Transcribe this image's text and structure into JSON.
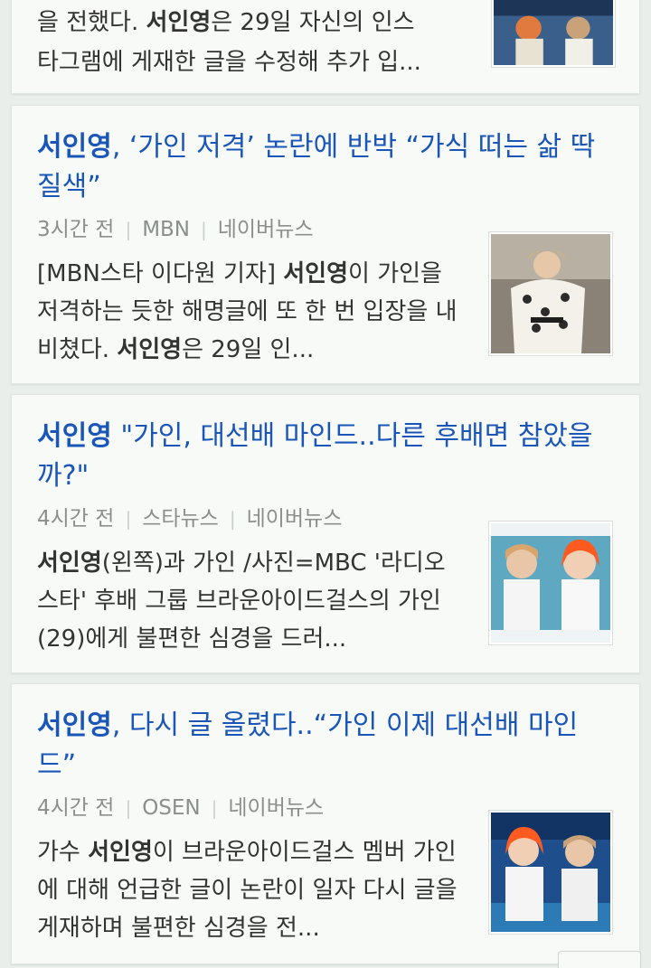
{
  "articles": [
    {
      "snippet_line1_pre": "을 전했다. ",
      "snippet_line1_hl": "서인영",
      "snippet_line1_post": "은 29일 자신의 인스",
      "snippet_line2": "타그램에 게재한 글을 수정해 추가 입..."
    },
    {
      "title_hl": "서인영",
      "title_rest": ", ‘가인 저격’ 논란에 반박 “가식 떠는 삶 딱 질색”",
      "time": "3시간 전",
      "press": "MBN",
      "source": "네이버뉴스",
      "snippet_pre": "[MBN스타 이다원 기자] ",
      "snippet_hl1": "서인영",
      "snippet_mid": "이 가인을 저격하는 듯한 해명글에 또 한 번 입장을 내비쳤다. ",
      "snippet_hl2": "서인영",
      "snippet_post": "은 29일 인..."
    },
    {
      "title_hl": "서인영",
      "title_rest": " \"가인, 대선배 마인드..다른 후배면 참았을까?\"",
      "time": "4시간 전",
      "press": "스타뉴스",
      "source": "네이버뉴스",
      "snippet_hl1": "서인영",
      "snippet_post": "(왼쪽)과 가인 /사진=MBC '라디오스타' 후배 그룹 브라운아이드걸스의 가인(29)에게 불편한 심경을 드러..."
    },
    {
      "title_hl": "서인영",
      "title_rest": ", 다시 글 올렸다..“가인 이제 대선배 마인드”",
      "time": "4시간 전",
      "press": "OSEN",
      "source": "네이버뉴스",
      "snippet_pre": "가수 ",
      "snippet_hl1": "서인영",
      "snippet_post": "이 브라운아이드걸스 멤버 가인에 대해 언급한 글이 논란이 일자 다시 글을 게재하며 불편한 심경을 전..."
    }
  ]
}
